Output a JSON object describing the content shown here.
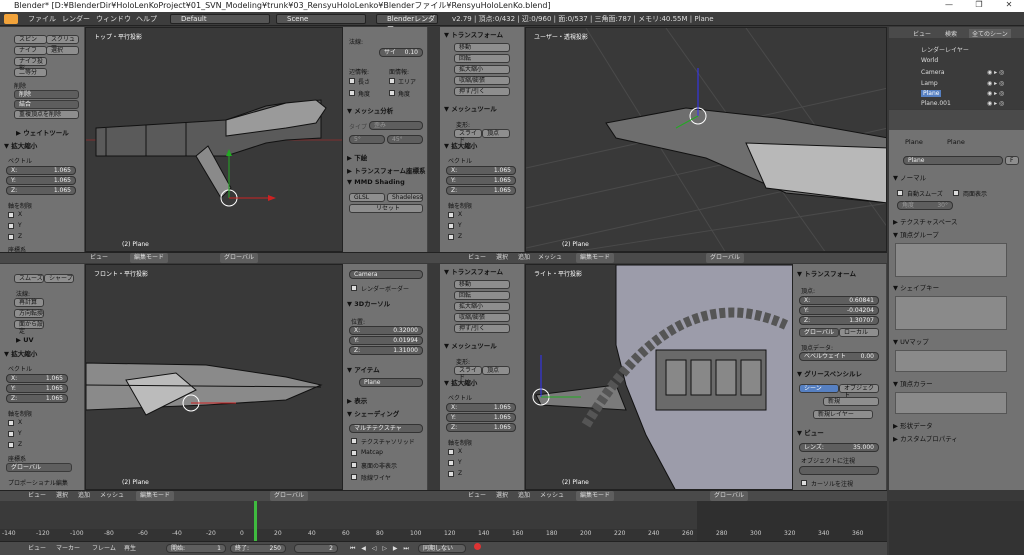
{
  "window": {
    "title": "Blender* [D:¥BlenderDir¥HoloLenKoProject¥01_SVN_Modeling¥trunk¥03_RensyuHoloLenko¥Blenderファイル¥RensyuHoloLenKo.blend]"
  },
  "menubar": {
    "file": "ファイル",
    "render": "レンダー",
    "window": "ウィンドウ",
    "help": "ヘルプ",
    "layout": "Default",
    "scene": "Scene",
    "engine": "Blenderレンダー",
    "stats": "v2.79 | 頂点:0/432 | 辺:0/960 | 面:0/537 | 三角面:787 | メモリ:40.55M | Plane"
  },
  "viewports": {
    "top_left": {
      "title": "トップ・平行投影",
      "object": "(2) Plane"
    },
    "top_right": {
      "title": "ユーザー・透視投影",
      "object": "(2) Plane"
    },
    "bottom_left": {
      "title": "フロント・平行投影",
      "object": "(2) Plane"
    },
    "bottom_right": {
      "title": "ライト・平行投影",
      "object": "(2) Plane"
    }
  },
  "vp_header": {
    "view": "ビュー",
    "select": "選択",
    "add": "追加",
    "mesh": "メッシュ",
    "mode": "編集モード",
    "global": "グローバル"
  },
  "toolshelf_tl": {
    "items": [
      "スピン",
      "スクリュー",
      "ナイフ",
      "選択",
      "ナイフ投影",
      "二等分"
    ],
    "delete_label": "削除",
    "delete": "削除",
    "merge": "結合",
    "remove_doubles": "重複頂点を削除",
    "weight_tools": "ウェイトツール",
    "resize": "拡大縮小",
    "vector": "ベクトル",
    "x": "X:",
    "xv": "1.065",
    "y": "Y:",
    "yv": "1.065",
    "z": "Z:",
    "zv": "1.065",
    "constraint": "軸を制限",
    "cx": "X",
    "cy": "Y",
    "cz": "Z",
    "coord": "座標系"
  },
  "npanel_tl": {
    "normals": "法線:",
    "size_label": "サイ",
    "size": "0.10",
    "edge_info": "辺情報:",
    "face_info": "面情報:",
    "length": "長さ",
    "area": "エリア",
    "angle": "角度",
    "angle2": "角度",
    "mesh_analysis": "メッシュ分析",
    "type_label": "タイプ",
    "type_value": "歪み",
    "min": "5°",
    "max": "45°",
    "background": "下絵",
    "transform_orient": "トランスフォーム座標系",
    "mmd": "MMD Shading",
    "glsl": "GLSL",
    "shadeless": "Shadeless",
    "reset": "リセット"
  },
  "toolshelf_tr": {
    "transform": "トランスフォーム",
    "move": "移動",
    "rotate": "回転",
    "scale": "拡大縮小",
    "shrink": "収縮/膨張",
    "push": "押す/引く",
    "mesh_tools": "メッシュツール",
    "deform": "変形:",
    "slide": "スライド",
    "vertex": "頂点",
    "resize": "拡大縮小",
    "vector": "ベクトル",
    "x": "X:",
    "xv": "1.065",
    "y": "Y:",
    "yv": "1.065",
    "z": "Z:",
    "zv": "1.065",
    "constraint": "軸を制限",
    "cx": "X",
    "cy": "Y",
    "cz": "Z"
  },
  "toolshelf_bl": {
    "smooth": "スムーズ",
    "sharp": "シャープ",
    "normals": "法線:",
    "recalc": "再計算",
    "flip": "方向転換",
    "from_face": "面から設定",
    "uv": "UV",
    "resize": "拡大縮小",
    "vector": "ベクトル",
    "x": "X:",
    "xv": "1.065",
    "y": "Y:",
    "yv": "1.065",
    "z": "Z:",
    "zv": "1.065",
    "constraint": "軸を制限",
    "cx": "X",
    "cy": "Y",
    "cz": "Z",
    "coord": "座標系",
    "global": "グローバル",
    "proportional": "プロポーショナル編集"
  },
  "npanel_bl": {
    "camera": "Camera",
    "render_border": "レンダーボーダー",
    "cursor3d": "3Dカーソル",
    "location": "位置:",
    "x": "X:",
    "xv": "0.32000",
    "y": "Y:",
    "yv": "0.01994",
    "z": "Z:",
    "zv": "1.31000",
    "item": "アイテム",
    "plane": "Plane",
    "display": "表示",
    "shading": "シェーディング",
    "multitexture": "マルチテクスチャ",
    "texture_solid": "テクスチャソリッド",
    "matcap": "Matcap",
    "backface": "裏面の非表示",
    "wire": "陰線ワイヤ"
  },
  "toolshelf_br": {
    "transform": "トランスフォーム",
    "move": "移動",
    "rotate": "回転",
    "scale": "拡大縮小",
    "shrink": "収縮/膨張",
    "push": "押す/引く",
    "mesh_tools": "メッシュツール",
    "deform": "変形:",
    "slide": "スライド",
    "vertex": "頂点",
    "resize": "拡大縮小",
    "vector": "ベクトル",
    "x": "X:",
    "xv": "1.065",
    "y": "Y:",
    "yv": "1.065",
    "z": "Z:",
    "zv": "1.065",
    "constraint": "軸を制限",
    "cx": "X",
    "cy": "Y",
    "cz": "Z"
  },
  "npanel_br": {
    "transform": "トランスフォーム",
    "vertex": "頂点:",
    "x": "X:",
    "xv": "0.60841",
    "y": "Y:",
    "yv": "-0.04204",
    "z": "Z:",
    "zv": "1.30707",
    "global": "グローバル",
    "local": "ローカル",
    "vertex_data": "頂点データ:",
    "bevel_weight": "ベベルウェイト",
    "bw": "0.00",
    "grease": "グリースペンシルレ",
    "scene": "シーン",
    "object": "オブジェクト",
    "new": "新規",
    "new_layer": "新規レイヤー",
    "view": "ビュー",
    "lens": "レンズ:",
    "lens_v": "35.000",
    "lock_obj": "オブジェクトに注視",
    "lock_cursor": "カーソルを注視"
  },
  "outliner": {
    "view": "ビュー",
    "search": "検索",
    "all_scenes": "全てのシーン",
    "items": [
      "レンダーレイヤー",
      "World",
      "Camera",
      "Lamp",
      "Plane",
      "Plane.001"
    ]
  },
  "properties": {
    "object": "Plane",
    "mesh": "Plane",
    "mesh_name": "Plane",
    "f": "F",
    "normals": "ノーマル",
    "auto_smooth": "自動スムーズ",
    "double_sided": "両面表示",
    "angle_label": "角度",
    "angle": "30°",
    "texture_space": "テクスチャスペース",
    "vertex_groups": "頂点グループ",
    "shape_keys": "シェイプキー",
    "uv_maps": "UVマップ",
    "vertex_colors": "頂点カラー",
    "geometry": "形状データ",
    "custom_props": "カスタムプロパティ"
  },
  "timeline": {
    "ticks": [
      "-140",
      "-120",
      "-100",
      "-80",
      "-60",
      "-40",
      "-20",
      "0",
      "20",
      "40",
      "60",
      "80",
      "100",
      "120",
      "140",
      "160",
      "180",
      "200",
      "220",
      "240",
      "260",
      "280",
      "300",
      "320",
      "340",
      "360"
    ],
    "view": "ビュー",
    "marker": "マーカー",
    "frame": "フレーム",
    "playback": "再生",
    "start_label": "開始:",
    "start": "1",
    "end_label": "終了:",
    "end": "250",
    "current": "2",
    "sync": "同期しない"
  }
}
